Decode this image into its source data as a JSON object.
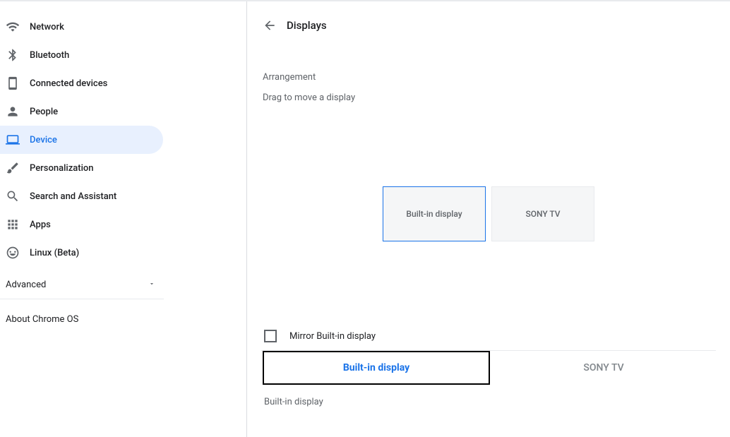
{
  "sidebar": {
    "items": [
      {
        "label": "Network",
        "icon": "wifi"
      },
      {
        "label": "Bluetooth",
        "icon": "bluetooth"
      },
      {
        "label": "Connected devices",
        "icon": "phone"
      },
      {
        "label": "People",
        "icon": "person"
      },
      {
        "label": "Device",
        "icon": "laptop",
        "active": true
      },
      {
        "label": "Personalization",
        "icon": "brush"
      },
      {
        "label": "Search and Assistant",
        "icon": "search"
      },
      {
        "label": "Apps",
        "icon": "apps"
      },
      {
        "label": "Linux (Beta)",
        "icon": "linux"
      }
    ],
    "advanced_label": "Advanced",
    "about_label": "About Chrome OS"
  },
  "header": {
    "title": "Displays"
  },
  "arrangement": {
    "title": "Arrangement",
    "subtitle": "Drag to move a display",
    "displays": [
      {
        "label": "Built-in display",
        "primary": true
      },
      {
        "label": "SONY TV",
        "primary": false
      }
    ]
  },
  "mirror": {
    "label": "Mirror Built-in display"
  },
  "tabs": [
    {
      "label": "Built-in display",
      "active": true
    },
    {
      "label": "SONY TV",
      "active": false
    }
  ],
  "subsection": {
    "title": "Built-in display"
  }
}
